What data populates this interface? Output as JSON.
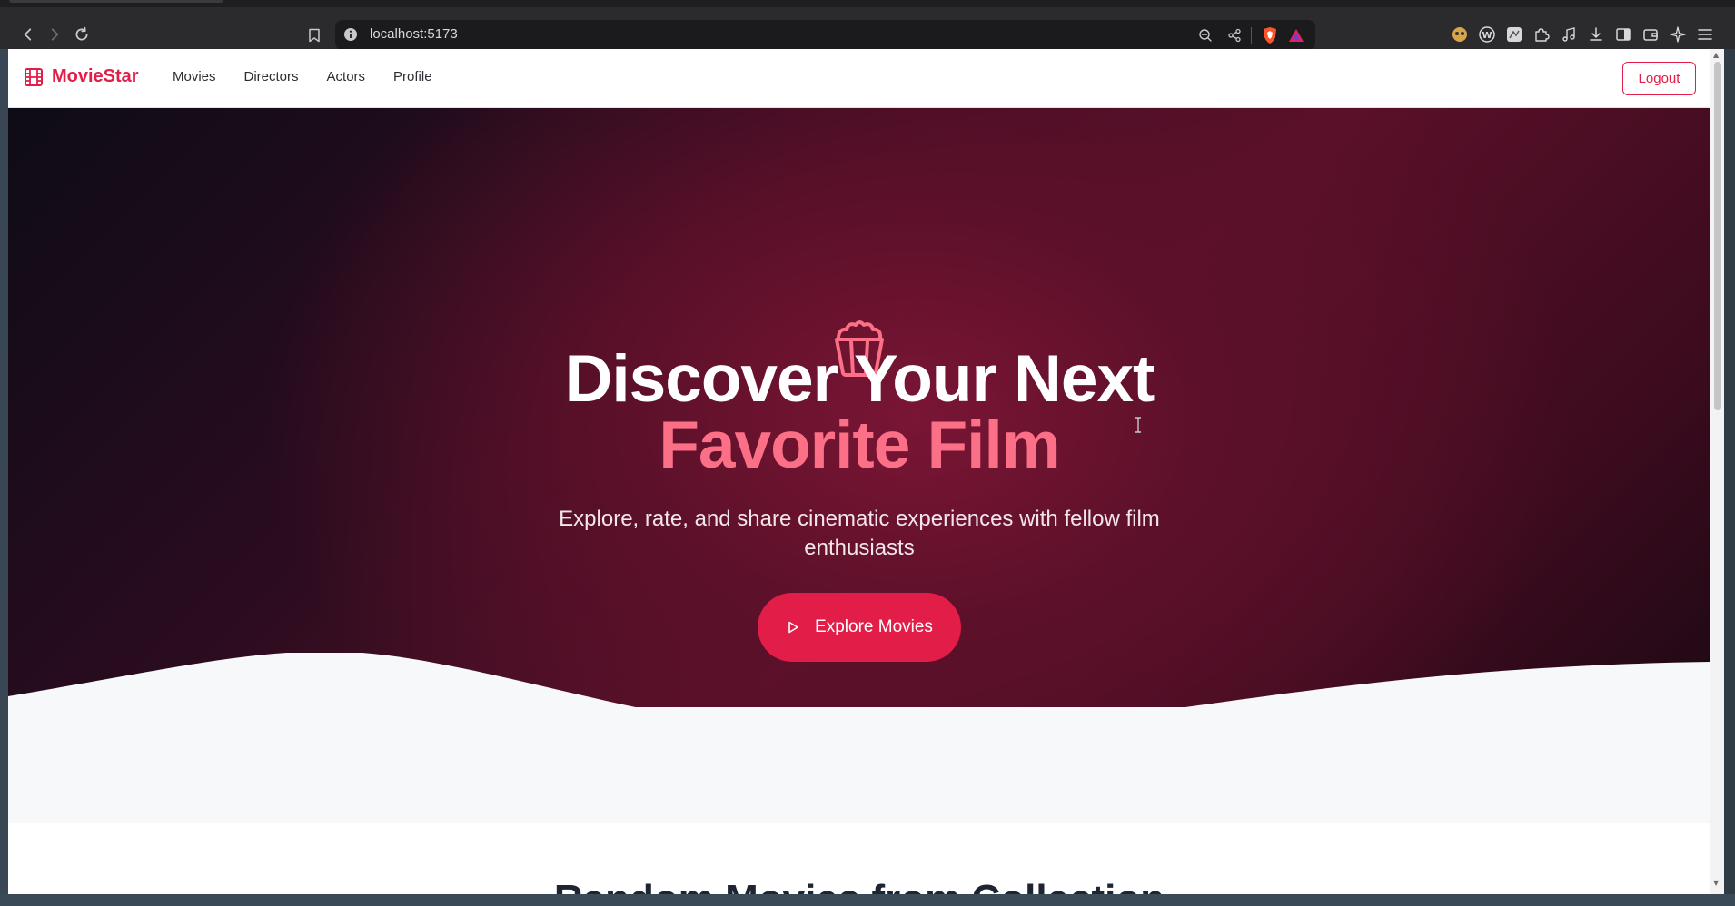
{
  "browser": {
    "url": "localhost:5173",
    "icons": {
      "back": "back-arrow-icon",
      "forward": "forward-arrow-icon",
      "reload": "reload-icon",
      "bookmark": "bookmark-icon",
      "info": "site-info-icon",
      "zoom": "zoom-out-icon",
      "share": "share-icon",
      "brave_shield": "brave-shield-icon",
      "brave_rewards": "brave-rewards-icon",
      "extensions": [
        "extension-icon-1",
        "extension-icon-2",
        "extension-icon-3",
        "puzzle-icon",
        "music-icon",
        "download-icon",
        "sidebar-icon",
        "wallet-icon",
        "leo-icon",
        "menu-icon"
      ]
    }
  },
  "site": {
    "brand": "MovieStar",
    "nav": [
      "Movies",
      "Directors",
      "Actors",
      "Profile"
    ],
    "logout_label": "Logout",
    "colors": {
      "accent": "#e11d48",
      "accent_light": "#fb6f87"
    }
  },
  "hero": {
    "title_line1": "Discover Your Next",
    "title_line2": "Favorite Film",
    "subtitle": "Explore, rate, and share cinematic experiences with fellow film enthusiasts",
    "cta_label": "Explore Movies",
    "icon": "popcorn-icon"
  },
  "next_section": {
    "heading": "Random Movies from Collection"
  }
}
